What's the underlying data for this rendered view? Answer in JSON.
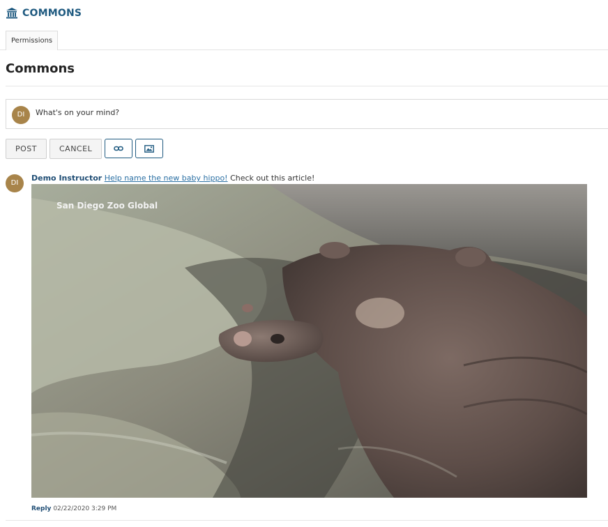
{
  "tool": {
    "title": "COMMONS",
    "icon": "bank-icon"
  },
  "tabs": [
    {
      "label": "Permissions"
    }
  ],
  "page": {
    "title": "Commons"
  },
  "composer": {
    "avatar_initials": "DI",
    "placeholder": "What's on your mind?"
  },
  "buttons": {
    "post": "POST",
    "cancel": "CANCEL",
    "link_icon": "link-icon",
    "image_icon": "image-icon"
  },
  "post": {
    "avatar_initials": "DI",
    "author": "Demo Instructor",
    "link_text": "Help name the new baby hippo!",
    "text": " Check out this article!",
    "image_watermark": "San Diego Zoo Global",
    "reply_label": "Reply",
    "timestamp": "02/22/2020 3:29 PM"
  },
  "colors": {
    "accent": "#1f5a80",
    "avatar": "#a8844a",
    "link": "#2a6fa3"
  }
}
